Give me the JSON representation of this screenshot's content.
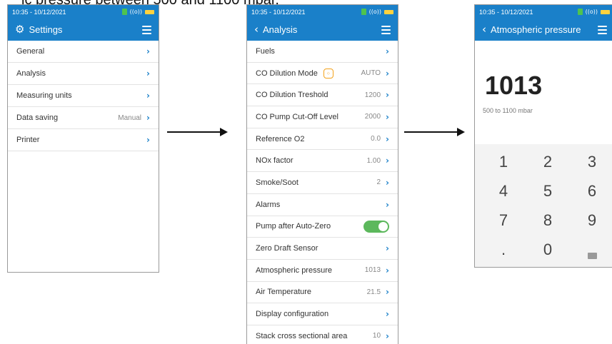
{
  "caption": {
    "text": "ic pressure between 500 and 1100 mbar."
  },
  "screen1": {
    "status": {
      "time": "10:35 - 10/12/2021",
      "signal": "((o))"
    },
    "title": "Settings",
    "items": [
      {
        "label": "General",
        "value": ""
      },
      {
        "label": "Analysis",
        "value": ""
      },
      {
        "label": "Measuring units",
        "value": ""
      },
      {
        "label": "Data saving",
        "value": "Manual"
      },
      {
        "label": "Printer",
        "value": ""
      }
    ]
  },
  "screen2": {
    "status": {
      "time": "10:35 - 10/12/2021",
      "signal": "((o))"
    },
    "title": "Analysis",
    "items": [
      {
        "label": "Fuels",
        "value": ""
      },
      {
        "label": "CO Dilution Mode",
        "value": "AUTO"
      },
      {
        "label": "CO Dilution Treshold",
        "value": "1200"
      },
      {
        "label": "CO Pump Cut-Off Level",
        "value": "2000"
      },
      {
        "label": "Reference O2",
        "value": "0.0"
      },
      {
        "label": "NOx factor",
        "value": "1.00"
      },
      {
        "label": "Smoke/Soot",
        "value": "2"
      },
      {
        "label": "Alarms",
        "value": ""
      },
      {
        "label": "Pump after Auto-Zero",
        "value": ""
      },
      {
        "label": "Zero Draft Sensor",
        "value": ""
      },
      {
        "label": "Atmospheric pressure",
        "value": "1013"
      },
      {
        "label": "Air Temperature",
        "value": "21.5"
      },
      {
        "label": "Display configuration",
        "value": ""
      },
      {
        "label": "Stack cross sectional area",
        "value": "10"
      }
    ],
    "toggle_on": true
  },
  "screen3": {
    "status": {
      "time": "10:35 - 10/12/2021",
      "signal": "((o))"
    },
    "title": "Atmospheric pressure",
    "value": "1013",
    "range": "500 to 1100 mbar",
    "keys": [
      "1",
      "2",
      "3",
      "4",
      "5",
      "6",
      "7",
      "8",
      "9",
      ".",
      "0"
    ]
  },
  "icons": {
    "settings": "gear-icon",
    "back": "chevron-left-icon",
    "menu": "hamburger-icon",
    "row": "chevron-right-icon",
    "backspace": "backspace-icon",
    "dilution": "dilution-badge-icon"
  },
  "colors": {
    "header": "#1a80c9",
    "toggle": "#5cb85c",
    "badge": "#f3a21a",
    "battery": "#ffd23f",
    "plug": "#4fc34f"
  }
}
